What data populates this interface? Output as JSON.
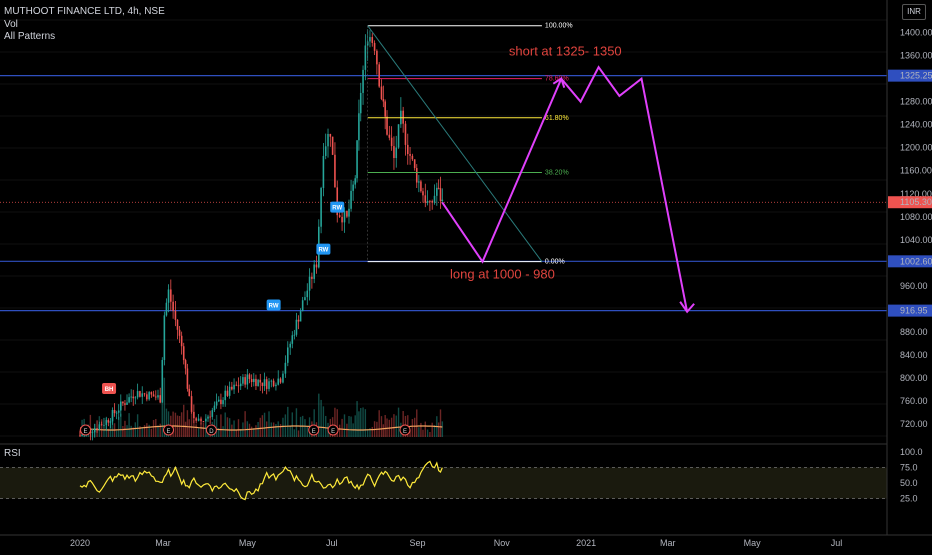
{
  "header": {
    "symbol_line": "MUTHOOT FINANCE LTD, 4h, NSE",
    "vol_label": "Vol",
    "patterns_label": "All Patterns",
    "rsi_label": "RSI",
    "currency": "INR"
  },
  "colors": {
    "up": "#26a69a",
    "down": "#ef5350",
    "hline": "#2f4fbf",
    "fib_100": "#ffffff",
    "fib_786": "#e91e63",
    "fib_618": "#ffeb3b",
    "fib_382": "#4caf50",
    "fib_0": "#ffffff",
    "projection": "#e040fb",
    "rsi": "#ffeb3b",
    "annotation": "#e0443e"
  },
  "chart_data": {
    "type": "candlestick",
    "symbol": "MUTHOOT FINANCE LTD",
    "interval": "4h",
    "exchange": "NSE",
    "ylim": [
      700,
      1420
    ],
    "y_ticks": [
      "1400.00",
      "1360.00",
      "1320.00",
      "1280.00",
      "1240.00",
      "1200.00",
      "1160.00",
      "1120.00",
      "1080.00",
      "1040.00",
      "960.00",
      "880.00",
      "840.00",
      "800.00",
      "760.00",
      "720.00"
    ],
    "x_ticks": [
      "2020",
      "Mar",
      "May",
      "Jul",
      "Sep",
      "Nov",
      "2021",
      "Mar",
      "May",
      "Jul"
    ],
    "price_series": [
      {
        "t": "2020-01-01",
        "close": 700
      },
      {
        "t": "2020-01-10",
        "close": 712
      },
      {
        "t": "2020-01-20",
        "close": 725
      },
      {
        "t": "2020-02-01",
        "close": 755
      },
      {
        "t": "2020-02-10",
        "close": 775
      },
      {
        "t": "2020-02-20",
        "close": 770
      },
      {
        "t": "2020-02-28",
        "close": 765
      },
      {
        "t": "2020-03-02",
        "close": 910
      },
      {
        "t": "2020-03-05",
        "close": 950
      },
      {
        "t": "2020-03-10",
        "close": 900
      },
      {
        "t": "2020-03-16",
        "close": 840
      },
      {
        "t": "2020-03-20",
        "close": 760
      },
      {
        "t": "2020-03-25",
        "close": 720
      },
      {
        "t": "2020-04-01",
        "close": 730
      },
      {
        "t": "2020-04-15",
        "close": 770
      },
      {
        "t": "2020-05-01",
        "close": 800
      },
      {
        "t": "2020-05-15",
        "close": 790
      },
      {
        "t": "2020-05-25",
        "close": 800
      },
      {
        "t": "2020-06-01",
        "close": 860
      },
      {
        "t": "2020-06-10",
        "close": 930
      },
      {
        "t": "2020-06-20",
        "close": 1000
      },
      {
        "t": "2020-06-25",
        "close": 1200
      },
      {
        "t": "2020-06-30",
        "close": 1230
      },
      {
        "t": "2020-07-05",
        "close": 1090
      },
      {
        "t": "2020-07-12",
        "close": 1075
      },
      {
        "t": "2020-07-18",
        "close": 1150
      },
      {
        "t": "2020-07-22",
        "close": 1300
      },
      {
        "t": "2020-07-27",
        "close": 1400
      },
      {
        "t": "2020-08-01",
        "close": 1380
      },
      {
        "t": "2020-08-06",
        "close": 1290
      },
      {
        "t": "2020-08-10",
        "close": 1230
      },
      {
        "t": "2020-08-15",
        "close": 1180
      },
      {
        "t": "2020-08-20",
        "close": 1250
      },
      {
        "t": "2020-08-25",
        "close": 1200
      },
      {
        "t": "2020-08-30",
        "close": 1160
      },
      {
        "t": "2020-09-05",
        "close": 1120
      },
      {
        "t": "2020-09-10",
        "close": 1095
      },
      {
        "t": "2020-09-15",
        "close": 1130
      },
      {
        "t": "2020-09-19",
        "close": 1105
      }
    ],
    "current_price": "1105.30",
    "horizontal_levels": [
      {
        "label": "1325.25",
        "value": 1325.25
      },
      {
        "label": "1002.60",
        "value": 1002.6
      },
      {
        "label": "916.95",
        "value": 916.95
      }
    ],
    "fibonacci": [
      {
        "label": "100.00%",
        "value": 1412
      },
      {
        "label": "78.60%",
        "value": 1320
      },
      {
        "label": "61.80%",
        "value": 1252
      },
      {
        "label": "38.20%",
        "value": 1157
      },
      {
        "label": "0.00%",
        "value": 1002
      }
    ],
    "projection_path": [
      {
        "t": "2020-09-19",
        "value": 1105
      },
      {
        "t": "2020-10-18",
        "value": 1002
      },
      {
        "t": "2020-12-14",
        "value": 1320
      },
      {
        "t": "2020-12-28",
        "value": 1280
      },
      {
        "t": "2021-01-10",
        "value": 1340
      },
      {
        "t": "2021-01-25",
        "value": 1290
      },
      {
        "t": "2021-02-10",
        "value": 1320
      },
      {
        "t": "2021-03-15",
        "value": 915
      }
    ],
    "annotations": [
      {
        "text": "short at 1325- 1350"
      },
      {
        "text": "long at 1000 -  980"
      }
    ],
    "pattern_badges": [
      "BH",
      "RW",
      "RW",
      "RW"
    ],
    "event_markers": [
      "E",
      "E",
      "D",
      "E",
      "E",
      "E"
    ],
    "rsi": {
      "levels": [
        "100.0",
        "75.0",
        "50.0",
        "25.0"
      ],
      "ylim": [
        0,
        100
      ]
    }
  }
}
